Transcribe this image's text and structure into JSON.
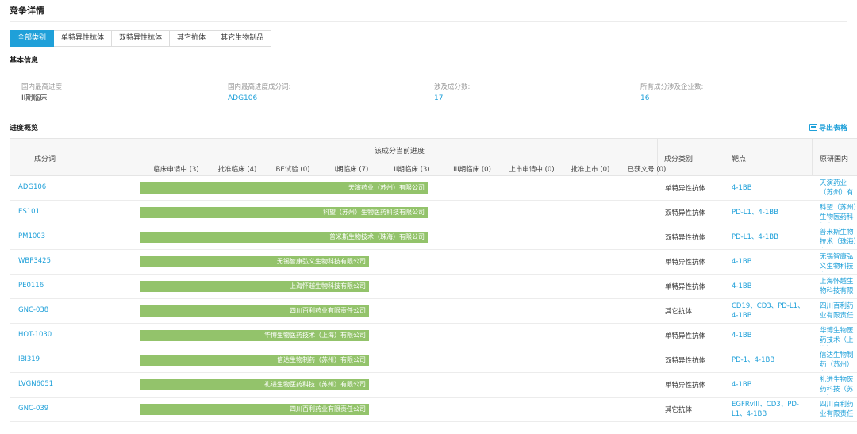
{
  "page": {
    "title": "竞争详情"
  },
  "tabs": [
    "全部类别",
    "单特异性抗体",
    "双特异性抗体",
    "其它抗体",
    "其它生物制品"
  ],
  "basic_info": {
    "title": "基本信息",
    "items": [
      {
        "label": "国内最高进度:",
        "value": "II期临床"
      },
      {
        "label": "国内最高进度成分词:",
        "value": "ADG106"
      },
      {
        "label": "涉及成分数:",
        "value": "17"
      },
      {
        "label": "所有成分涉及企业数:",
        "value": "16"
      }
    ]
  },
  "progress": {
    "title": "进度概览",
    "export_label": "导出表格",
    "headers": {
      "ingredient": "成分词",
      "current_progress": "该成分当前进度",
      "category": "成分类别",
      "target": "靶点",
      "originator": "原研国内"
    },
    "stages": [
      "临床申请中 (3)",
      "批准临床 (4)",
      "BE试验 (0)",
      "I期临床 (7)",
      "II期临床 (3)",
      "III期临床 (0)",
      "上市申请中 (0)",
      "批准上市 (0)",
      "已获文号 (0)"
    ],
    "rows": [
      {
        "name": "ADG106",
        "company": "天演药业（苏州）有限公司",
        "reached_stage": "II期临床",
        "category": "单特异性抗体",
        "target": "4-1BB",
        "originator": "天演药业（苏州）有限公司|II期"
      },
      {
        "name": "ES101",
        "company": "科望（苏州）生物医药科技有限公司",
        "reached_stage": "II期临床",
        "category": "双特异性抗体",
        "target": "PD-L1、4-1BB",
        "originator": "科望（苏州）生物医药科技有限"
      },
      {
        "name": "PM1003",
        "company": "普米斯生物技术（珠海）有限公司",
        "reached_stage": "II期临床",
        "category": "双特异性抗体",
        "target": "PD-L1、4-1BB",
        "originator": "普米斯生物技术（珠海）有限"
      },
      {
        "name": "WBP3425",
        "company": "无锡智康弘义生物科技有限公司",
        "reached_stage": "I期临床",
        "category": "单特异性抗体",
        "target": "4-1BB",
        "originator": "无锡智康弘义生物科技有限公司"
      },
      {
        "name": "PE0116",
        "company": "上海怀越生物科技有限公司",
        "reached_stage": "I期临床",
        "category": "单特异性抗体",
        "target": "4-1BB",
        "originator": "上海怀越生物科技有限公司|II期"
      },
      {
        "name": "GNC-038",
        "company": "四川百利药业有限责任公司",
        "reached_stage": "I期临床",
        "category": "其它抗体",
        "target": "CD19、CD3、PD-L1、4-1BB",
        "originator": "四川百利药业有限责任公司|II期"
      },
      {
        "name": "HOT-1030",
        "company": "华博生物医药技术（上海）有限公司",
        "reached_stage": "I期临床",
        "category": "单特异性抗体",
        "target": "4-1BB",
        "originator": "华博生物医药技术（上海）有限"
      },
      {
        "name": "IBI319",
        "company": "信达生物制药（苏州）有限公司",
        "reached_stage": "I期临床",
        "category": "双特异性抗体",
        "target": "PD-1、4-1BB",
        "originator": "信达生物制药（苏州）有限"
      },
      {
        "name": "LVGN6051",
        "company": "礼进生物医药科技（苏州）有限公司",
        "reached_stage": "I期临床",
        "category": "单特异性抗体",
        "target": "4-1BB",
        "originator": "礼进生物医药科技（苏州）有限"
      },
      {
        "name": "GNC-039",
        "company": "四川百利药业有限责任公司",
        "reached_stage": "I期临床",
        "category": "其它抗体",
        "target": "EGFRvIII、CD3、PD-L1、4-1BB",
        "originator": "四川百利药业有限责任公司|II期"
      }
    ]
  },
  "colors": {
    "accent": "#1fa0d9",
    "bar": "#93c36b"
  }
}
